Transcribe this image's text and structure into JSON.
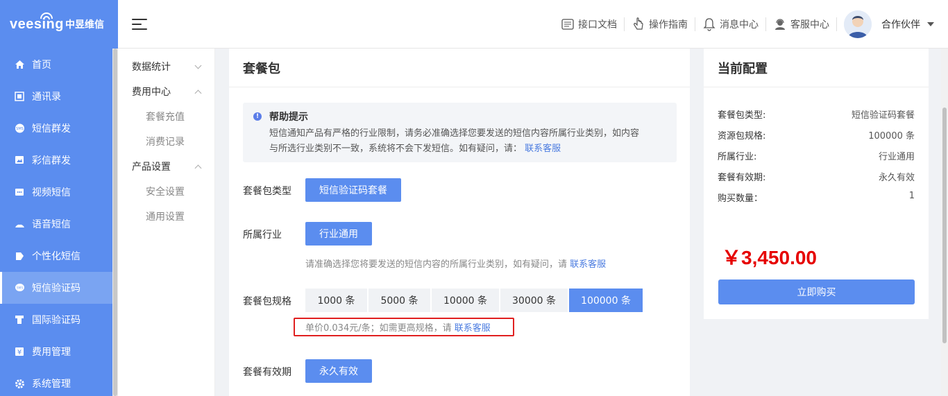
{
  "brand": {
    "logo_text": "veesing",
    "logo_cn": "中昱维信"
  },
  "sidebar": {
    "items": [
      {
        "label": "首页",
        "icon": "home-icon"
      },
      {
        "label": "通讯录",
        "icon": "contacts-icon"
      },
      {
        "label": "短信群发",
        "icon": "sms-icon"
      },
      {
        "label": "彩信群发",
        "icon": "mms-icon"
      },
      {
        "label": "视频短信",
        "icon": "video-sms-icon"
      },
      {
        "label": "语音短信",
        "icon": "voice-sms-icon"
      },
      {
        "label": "个性化短信",
        "icon": "personalized-sms-icon"
      },
      {
        "label": "短信验证码",
        "icon": "verification-code-icon",
        "active": true
      },
      {
        "label": "国际验证码",
        "icon": "international-code-icon"
      },
      {
        "label": "费用管理",
        "icon": "yen-icon"
      },
      {
        "label": "系统管理",
        "icon": "gear-icon"
      }
    ]
  },
  "header": {
    "links": [
      {
        "label": "接口文档",
        "icon": "api-doc-icon"
      },
      {
        "label": "操作指南",
        "icon": "hand-pointer-icon"
      },
      {
        "label": "消息中心",
        "icon": "bell-icon"
      },
      {
        "label": "客服中心",
        "icon": "support-icon"
      }
    ],
    "user_name": "合作伙伴"
  },
  "submenu": {
    "group_stats": "数据统计",
    "group_fee": "费用中心",
    "fee_items": [
      "套餐充值",
      "消费记录"
    ],
    "group_product": "产品设置",
    "product_items": [
      "安全设置",
      "通用设置"
    ]
  },
  "main": {
    "title": "套餐包",
    "help": {
      "title": "帮助提示",
      "line1": "短信通知产品有严格的行业限制，请务必准确选择您要发送的短信内容所属行业类别，如内容",
      "line2": "与所选行业类别不一致，系统将不会下发短信。如有疑问，请：",
      "link": "联系客服"
    },
    "type_label": "套餐包类型",
    "type_value": "短信验证码套餐",
    "industry_label": "所属行业",
    "industry_value": "行业通用",
    "industry_hint": "请准确选择您将要发送的短信内容的所属行业类别，如有疑问，请",
    "industry_hint_link": "联系客服",
    "spec_label": "套餐包规格",
    "specs": [
      "1000 条",
      "5000 条",
      "10000 条",
      "30000 条",
      "100000 条"
    ],
    "selected_spec_index": 4,
    "price_note": "单价0.034元/条；如需更高规格，请",
    "price_note_link": "联系客服",
    "validity_label": "套餐有效期",
    "validity_value": "永久有效"
  },
  "config": {
    "title": "当前配置",
    "rows": [
      {
        "k": "套餐包类型:",
        "v": "短信验证码套餐"
      },
      {
        "k": "资源包规格:",
        "v": "100000 条"
      },
      {
        "k": "所属行业:",
        "v": "行业通用"
      },
      {
        "k": "套餐有效期:",
        "v": "永久有效"
      },
      {
        "k": "购买数量：",
        "v": "1"
      }
    ],
    "price": "￥3,450.00",
    "buy_label": "立即购买"
  },
  "colors": {
    "primary": "#5b8def",
    "price_red": "#e60000",
    "highlight_border": "#e02020"
  }
}
